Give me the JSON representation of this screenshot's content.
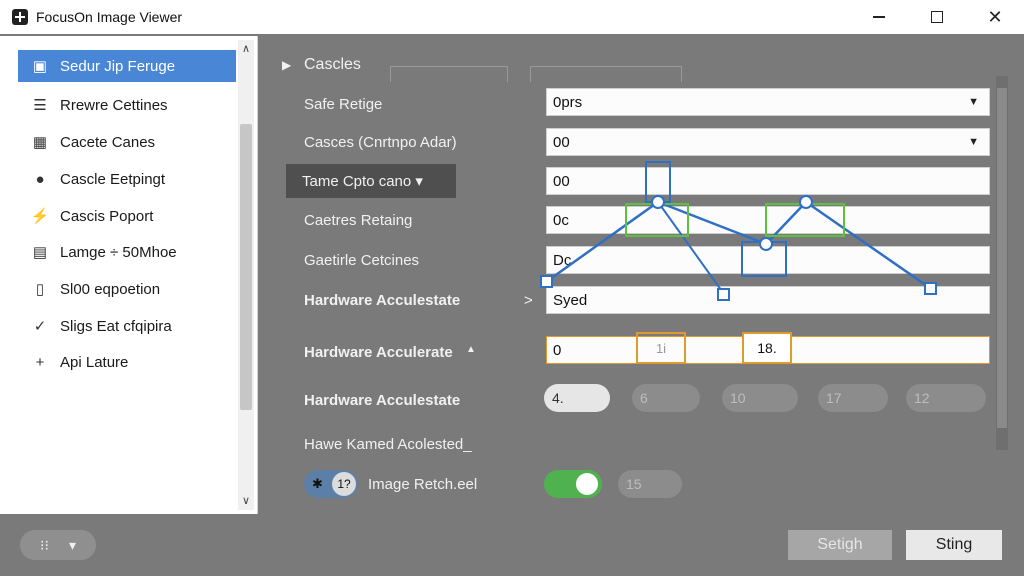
{
  "window": {
    "title": "FocusOn Image Viewer"
  },
  "sidebar": {
    "items": [
      {
        "label": "Sedur Jip Ferugе",
        "icon": "image-icon",
        "glyph": "▣"
      },
      {
        "label": "Rrewre Cettines",
        "icon": "list-icon",
        "glyph": "☰"
      },
      {
        "label": "Cacete Canes",
        "icon": "grid-icon",
        "glyph": "▦"
      },
      {
        "label": "Cascle Eetpingt",
        "icon": "circle-icon",
        "glyph": "●"
      },
      {
        "label": "Cascis Poport",
        "icon": "bolt-icon",
        "glyph": "⚡"
      },
      {
        "label": "Lamge ÷ 50Mhoe",
        "icon": "tiles-icon",
        "glyph": "▤"
      },
      {
        "label": "Sl00 eqpoetion",
        "icon": "page-icon",
        "glyph": "▯"
      },
      {
        "label": "Sligs Eat cfqipira",
        "icon": "check-icon",
        "glyph": "✓"
      },
      {
        "label": "Api Lature",
        "icon": "plus-icon",
        "glyph": "+"
      }
    ],
    "scroll_up": "∧",
    "scroll_down": "∨"
  },
  "main": {
    "section_toggle": "▶",
    "section_title": "Cascles",
    "rows": [
      {
        "label": "Safe Retige",
        "value": "0prs",
        "caret": "▼"
      },
      {
        "label": "Casces (Cnrtnpo Adar)",
        "value": "00",
        "caret": "▼"
      },
      {
        "label": "Caetres Retaing",
        "value": "0c"
      },
      {
        "label": "Gaetirle Cetcines",
        "value": "Dc"
      }
    ],
    "dropdown_button": "Tame Cpto cano ▾",
    "dropdown_value": "00",
    "hw1": {
      "label": "Hardware Acculestate",
      "arrow": ">",
      "value": "Syed"
    },
    "hw2": {
      "label": "Hardware Acculerate",
      "arrow": "▲",
      "value": "0",
      "box1": "1i",
      "box2": "18."
    },
    "hw3": {
      "label": "Hardware Acculestate",
      "pills": [
        "4.",
        "6",
        "10",
        "17",
        "12"
      ]
    },
    "hw4": {
      "label": "Hawe Kamed Acolested_"
    },
    "retch": {
      "chip_left": "✱",
      "chip_knob": "1?",
      "label": "Image Retch.eel",
      "value": "15"
    }
  },
  "bottombar": {
    "left_icon": "grid-icon",
    "left_glyph": "⁝⁝",
    "left_arrow": "▾",
    "secondary_button": "Setigh",
    "primary_button": "Sting"
  },
  "colors": {
    "accent": "#4a86d6",
    "toggle_on": "#4fb24f",
    "overlay_blue": "#2f6fc4",
    "overlay_green": "#5fbf3f",
    "overlay_orange": "#e09a2c"
  }
}
